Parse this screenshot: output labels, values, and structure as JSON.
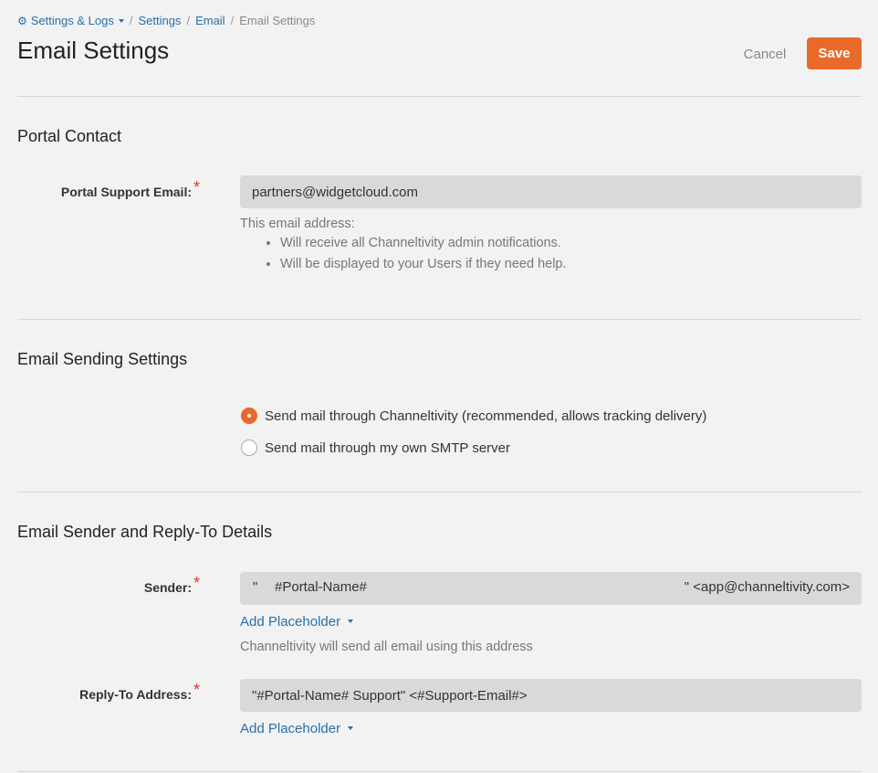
{
  "breadcrumb": {
    "root": "Settings & Logs",
    "settings": "Settings",
    "email": "Email",
    "current": "Email Settings",
    "separator": "/"
  },
  "page_title": "Email Settings",
  "actions": {
    "cancel": "Cancel",
    "save": "Save"
  },
  "colors": {
    "accent": "#e8692a",
    "link": "#2a6fa8",
    "required": "#d9362b"
  },
  "portal_contact": {
    "title": "Portal Contact",
    "support_email_label": "Portal Support Email:",
    "support_email_value": "partners@widgetcloud.com",
    "help_intro": "This email address:",
    "help_items": [
      "Will receive all Channeltivity admin notifications.",
      "Will be displayed to your Users if they need help."
    ]
  },
  "sending": {
    "title": "Email Sending Settings",
    "options": [
      {
        "label": "Send mail through Channeltivity (recommended, allows tracking delivery)",
        "selected": true
      },
      {
        "label": "Send mail through my own SMTP server",
        "selected": false
      }
    ]
  },
  "sender_details": {
    "title": "Email Sender and Reply-To Details",
    "sender_label": "Sender:",
    "sender_quote_open": "\"",
    "sender_placeholder": "#Portal-Name#",
    "sender_tail": "\" <app@channeltivity.com>",
    "add_placeholder": "Add Placeholder",
    "sender_help": "Channeltivity will send all email using this address",
    "reply_to_label": "Reply-To Address:",
    "reply_to_value": "\"#Portal-Name# Support\" <#Support-Email#>"
  },
  "required_mark": "*"
}
